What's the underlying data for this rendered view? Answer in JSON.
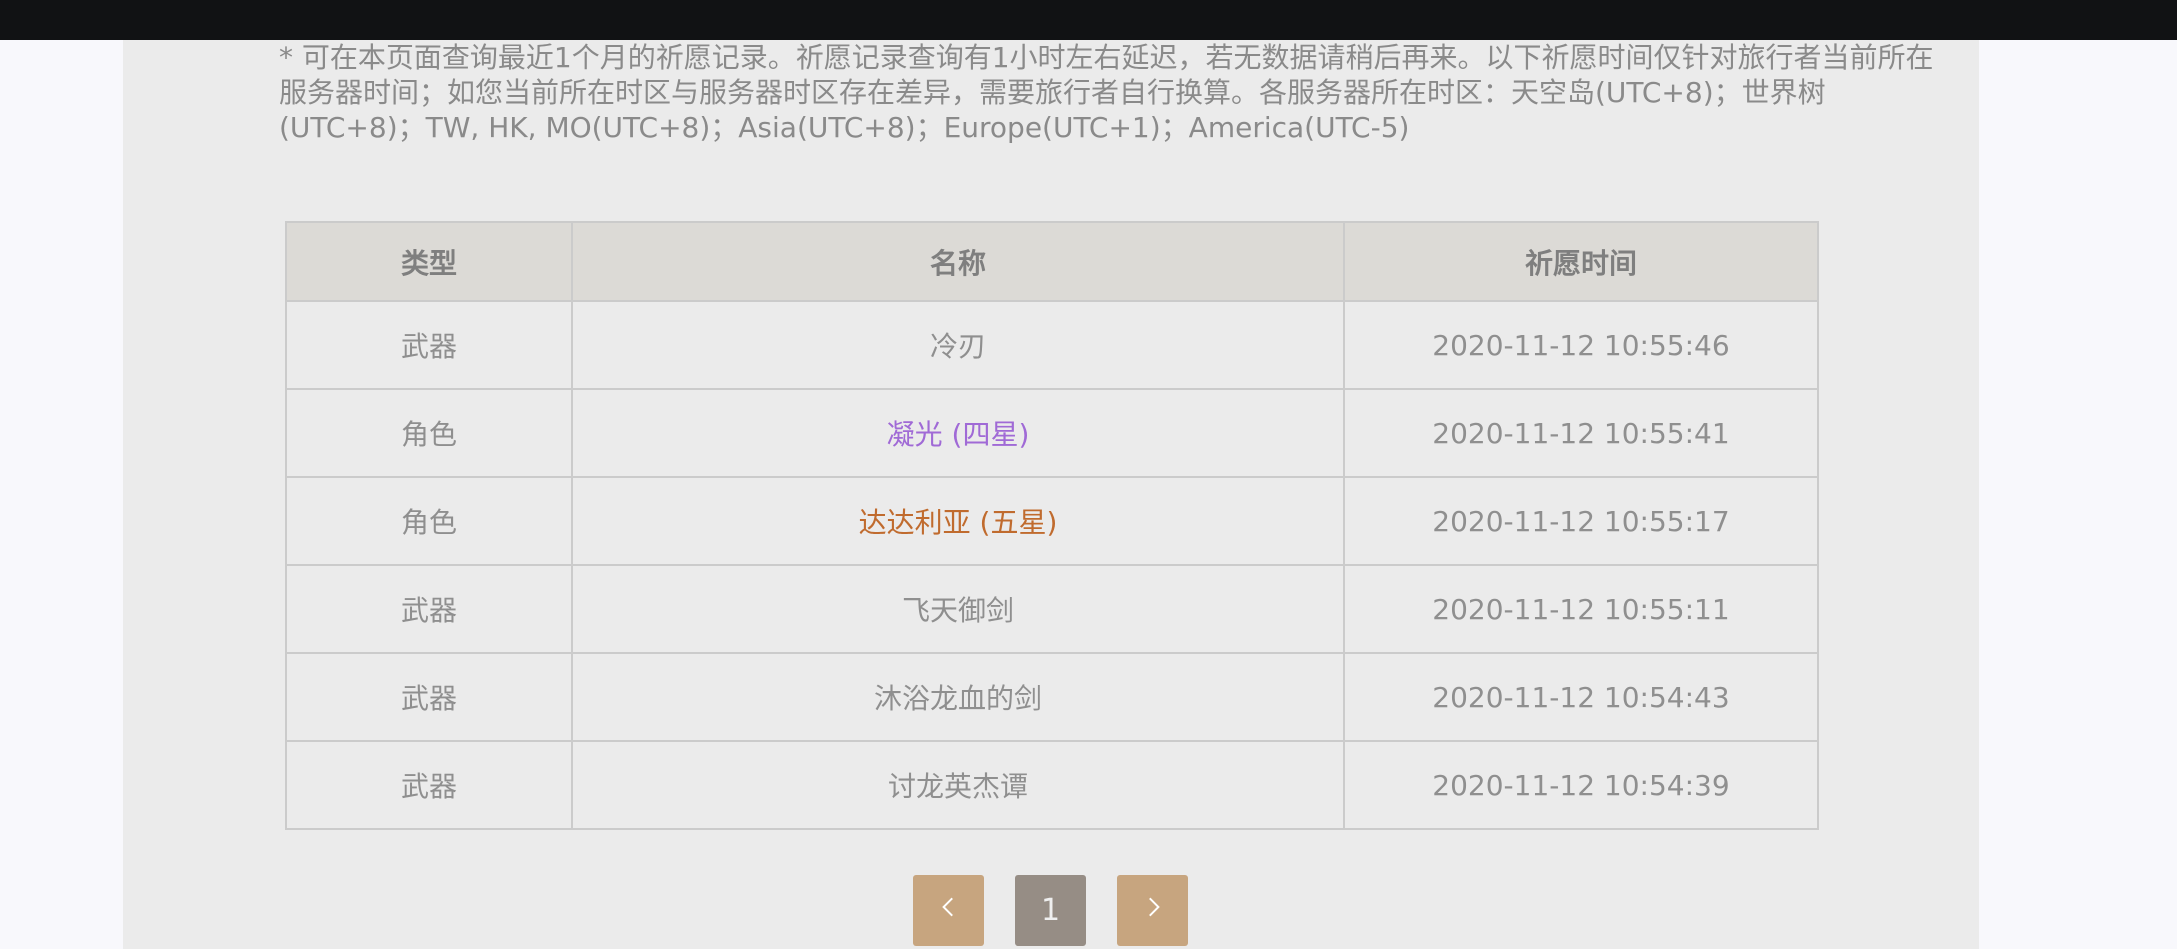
{
  "notice": "* 可在本页面查询最近1个月的祈愿记录。祈愿记录查询有1小时左右延迟，若无数据请稍后再来。以下祈愿时间仅针对旅行者当前所在服务器时间；如您当前所在时区与服务器时区存在差异，需要旅行者自行换算。各服务器所在时区：天空岛(UTC+8)；世界树(UTC+8)；TW, HK, MO(UTC+8)；Asia(UTC+8)；Europe(UTC+1)；America(UTC-5)",
  "table": {
    "headers": [
      "类型",
      "名称",
      "祈愿时间"
    ],
    "rows": [
      {
        "type": "武器",
        "name": "冷刃",
        "time": "2020-11-12 10:55:46",
        "rarity": "normal"
      },
      {
        "type": "角色",
        "name": "凝光 (四星)",
        "time": "2020-11-12 10:55:41",
        "rarity": "four-star"
      },
      {
        "type": "角色",
        "name": "达达利亚 (五星)",
        "time": "2020-11-12 10:55:17",
        "rarity": "five-star"
      },
      {
        "type": "武器",
        "name": "飞天御剑",
        "time": "2020-11-12 10:55:11",
        "rarity": "normal"
      },
      {
        "type": "武器",
        "name": "沐浴龙血的剑",
        "time": "2020-11-12 10:54:43",
        "rarity": "normal"
      },
      {
        "type": "武器",
        "name": "讨龙英杰谭",
        "time": "2020-11-12 10:54:39",
        "rarity": "normal"
      }
    ]
  },
  "pager": {
    "prev_icon": "chevron-left-icon",
    "current_page": "1",
    "next_icon": "chevron-right-icon"
  },
  "colors": {
    "four_star": "#a06ad6",
    "five_star": "#c06b2e",
    "pager_arrow": "#c7a57f",
    "pager_current": "#968d85"
  }
}
